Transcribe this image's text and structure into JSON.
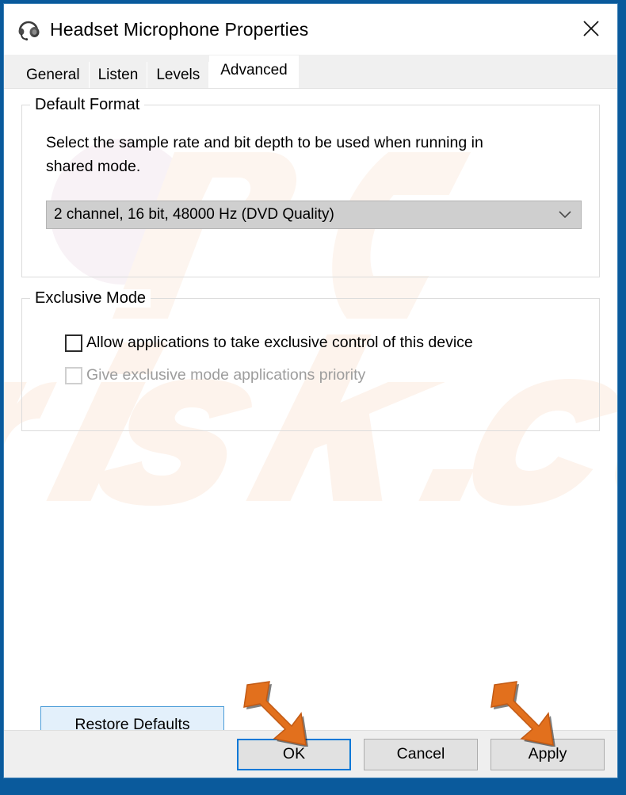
{
  "window": {
    "title": "Headset Microphone Properties",
    "icon": "headset-icon",
    "close_label": "✕",
    "accent_color": "#0a5a9c",
    "focus_border_color": "#0078d7"
  },
  "tabs": [
    {
      "label": "General",
      "selected": false
    },
    {
      "label": "Listen",
      "selected": false
    },
    {
      "label": "Levels",
      "selected": false
    },
    {
      "label": "Advanced",
      "selected": true
    }
  ],
  "default_format": {
    "legend": "Default Format",
    "description": "Select the sample rate and bit depth to be used when running in shared mode.",
    "combo": {
      "value": "2 channel, 16 bit, 48000 Hz (DVD Quality)",
      "arrow_icon": "chevron-down-icon"
    }
  },
  "exclusive_mode": {
    "legend": "Exclusive Mode",
    "checkboxes": [
      {
        "label": "Allow applications to take exclusive control of this device",
        "checked": false,
        "disabled": false
      },
      {
        "label": "Give exclusive mode applications priority",
        "checked": false,
        "disabled": true
      }
    ]
  },
  "restore_defaults": {
    "label": "Restore Defaults"
  },
  "footer": {
    "buttons": [
      {
        "label": "OK",
        "default": true
      },
      {
        "label": "Cancel",
        "default": false
      },
      {
        "label": "Apply",
        "default": false
      }
    ]
  },
  "annotations": {
    "arrow_color": "#e2701d",
    "arrows": [
      {
        "name": "arrow-pointing-to-ok-button",
        "points_to": "OK"
      },
      {
        "name": "arrow-pointing-to-apply-button",
        "points_to": "Apply"
      }
    ]
  },
  "watermark": {
    "text": "risk.com",
    "logo": "pc-logo",
    "color": "#fcf4ee"
  }
}
